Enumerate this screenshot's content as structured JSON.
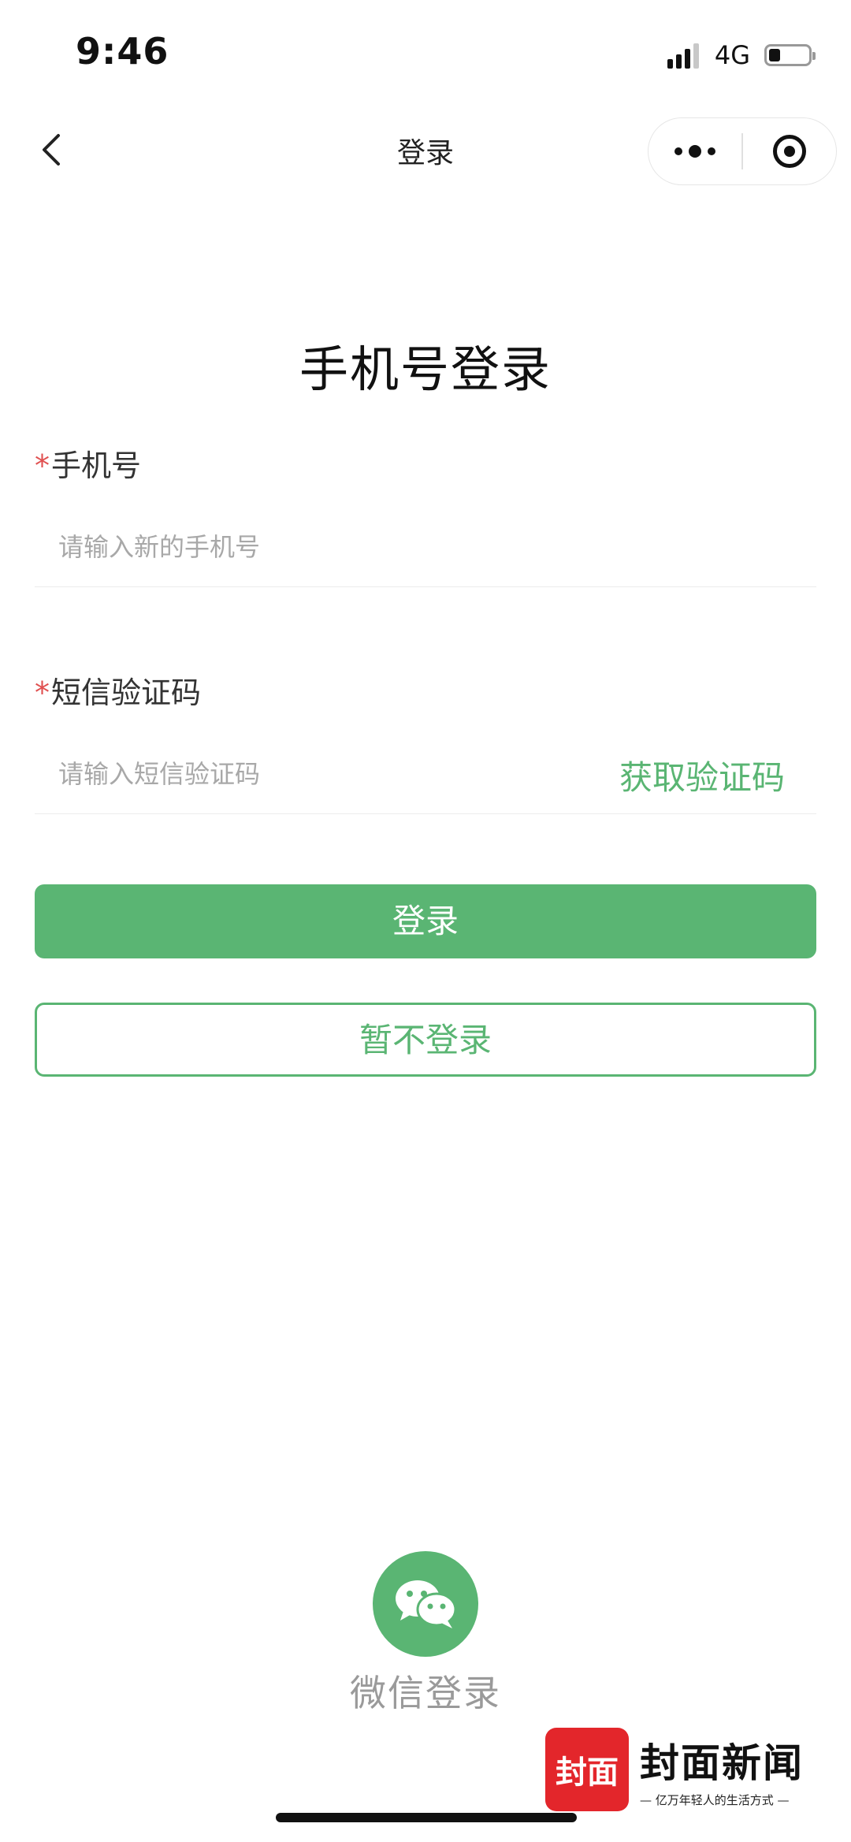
{
  "status_bar": {
    "time": "9:46",
    "network": "4G",
    "signal_level": 3,
    "signal_max": 4,
    "battery_level": 0.3
  },
  "nav": {
    "title": "登录",
    "back_icon": "chevron-left-icon",
    "more_icon": "more-dots-icon",
    "close_icon": "target-icon"
  },
  "form": {
    "title": "手机号登录",
    "required_mark": "*",
    "phone": {
      "label": "手机号",
      "value": "",
      "placeholder": "请输入新的手机号"
    },
    "code": {
      "label": "短信验证码",
      "value": "",
      "placeholder": "请输入短信验证码",
      "get_code_label": "获取验证码"
    },
    "login_label": "登录",
    "skip_label": "暂不登录"
  },
  "wechat": {
    "label": "微信登录",
    "icon": "wechat-icon"
  },
  "watermark": {
    "logo_text": "封面",
    "name": "封面新闻",
    "slogan": "— 亿万年轻人的生活方式 —"
  },
  "colors": {
    "accent": "#5ab573",
    "required": "#e05050",
    "placeholder": "#a8a8a8",
    "watermark_red": "#e3262b"
  }
}
